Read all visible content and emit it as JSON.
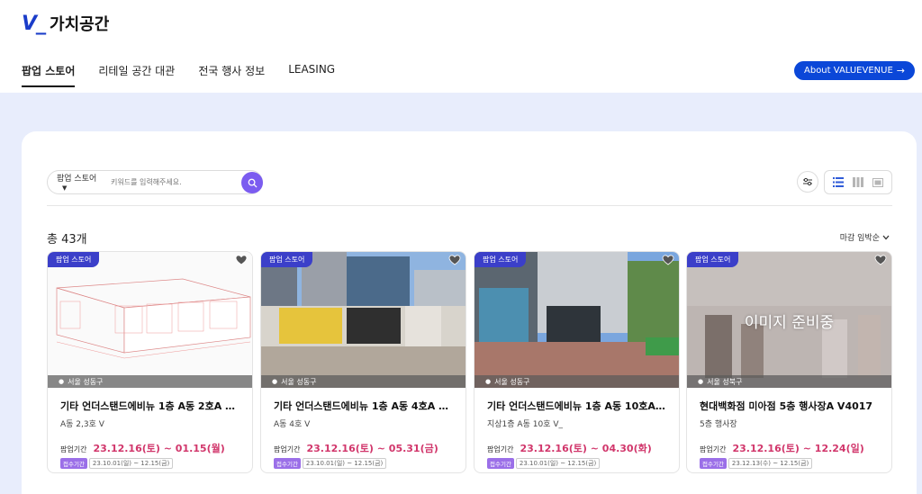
{
  "header": {
    "logo_mark": "V_",
    "logo_text": "가치공간",
    "nav": [
      "팝업 스토어",
      "리테일 공간 대관",
      "전국 행사 정보",
      "LEASING"
    ],
    "about_label": "About VALUEVENUE"
  },
  "search": {
    "category": "팝업 스토어",
    "placeholder": "키워드를 입력해주세요."
  },
  "list": {
    "count_label": "총 43개",
    "sort_label": "마감 임박순"
  },
  "cards": [
    {
      "badge": "팝업 스토어",
      "location": "서울 성동구",
      "title": "기타 언더스탠드에비뉴 1층 A동 2호A V_...",
      "subtitle": "A동 2,3호 V",
      "period_label": "팝업기간",
      "period": "23.12.16(토) ~ 01.15(월)",
      "reception_label": "접수기간",
      "reception": "23.10.01(일) ~ 12.15(금)"
    },
    {
      "badge": "팝업 스토어",
      "location": "서울 성동구",
      "title": "기타 언더스탠드에비뉴 1층 A동 4호A V_...",
      "subtitle": "A동 4호 V",
      "period_label": "팝업기간",
      "period": "23.12.16(토) ~ 05.31(금)",
      "reception_label": "접수기간",
      "reception": "23.10.01(일) ~ 12.15(금)"
    },
    {
      "badge": "팝업 스토어",
      "location": "서울 성동구",
      "title": "기타 언더스탠드에비뉴 1층 A동 10호A V_...",
      "subtitle": "지상1층 A동 10호 V_",
      "period_label": "팝업기간",
      "period": "23.12.16(토) ~ 04.30(화)",
      "reception_label": "접수기간",
      "reception": "23.10.01(일) ~ 12.15(금)"
    },
    {
      "badge": "팝업 스토어",
      "location": "서울 성북구",
      "placeholder": "이미지 준비중",
      "title": "현대백화점 미아점 5층 행사장A V4017",
      "subtitle": "5층 행사장",
      "period_label": "팝업기간",
      "period": "23.12.16(토) ~ 12.24(일)",
      "reception_label": "접수기간",
      "reception": "23.12.13(수) ~ 12.15(금)"
    }
  ],
  "colors": {
    "brand": "#1a3cc9",
    "about_button": "#0b47d8",
    "search_button": "#7b5cf0",
    "badge": "#3b3fc9",
    "period": "#d1366b",
    "background_band": "#e8edfc"
  },
  "icons": [
    "arrow-right-icon",
    "caret-down-icon",
    "search-icon",
    "filter-icon",
    "list-view-icon",
    "grid-view-icon",
    "map-view-icon",
    "chevron-down-icon",
    "heart-icon",
    "pin-icon"
  ]
}
